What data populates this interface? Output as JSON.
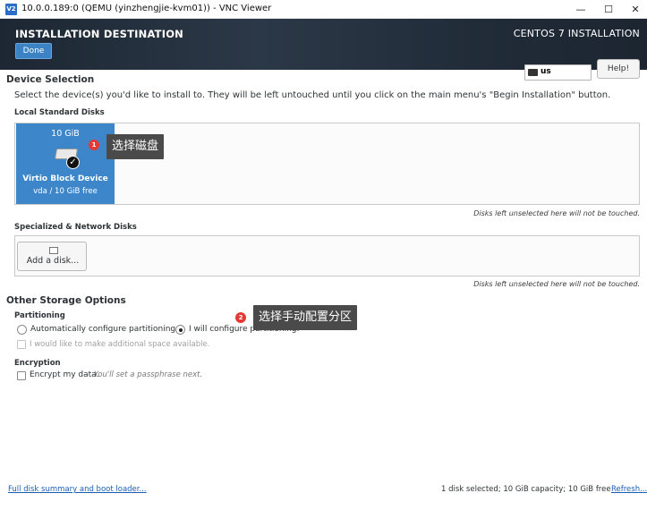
{
  "vnc": {
    "logo": "V2",
    "title": "10.0.0.189:0 (QEMU (yinzhengjie-kvm01)) - VNC Viewer",
    "minimize": "—",
    "maximize": "☐",
    "close": "✕"
  },
  "header": {
    "title": "INSTALLATION DESTINATION",
    "done_label": "Done",
    "product": "CENTOS 7 INSTALLATION",
    "keyboard_layout": "us",
    "help_label": "Help!"
  },
  "device_selection": {
    "title": "Device Selection",
    "description": "Select the device(s) you'd like to install to.  They will be left untouched until you click on the main menu's \"Begin Installation\" button.",
    "local_disks_title": "Local Standard Disks",
    "disk": {
      "size": "10 GiB",
      "name": "Virtio Block Device",
      "info": "vda  /  10 GiB free",
      "selected": true
    },
    "local_note": "Disks left unselected here will not be touched.",
    "specialized_title": "Specialized & Network Disks",
    "add_disk_label": "Add a disk...",
    "specialized_note": "Disks left unselected here will not be touched."
  },
  "other_storage": {
    "title": "Other Storage Options",
    "partitioning_title": "Partitioning",
    "auto_label": "Automatically configure partitioning.",
    "manual_label": "I will configure partitioning.",
    "selected_option": "manual",
    "extra_space_label": "I would like to make additional space available.",
    "encryption_title": "Encryption",
    "encrypt_label": "Encrypt my data.",
    "encrypt_hint": "You'll set a passphrase next."
  },
  "annotations": {
    "step1_number": "1",
    "step1_text": "选择磁盘",
    "step2_number": "2",
    "step2_text": "选择手动配置分区"
  },
  "footer": {
    "summary_link": "Full disk summary and boot loader...",
    "status": "1 disk selected; 10 GiB capacity; 10 GiB free",
    "refresh_link": "Refresh..."
  },
  "colors": {
    "selected_disk": "#3d86c9",
    "header_bg": "#2b3847",
    "callout_bg": "#4a4a4a",
    "badge": "#e53935",
    "link": "#1a5fb4"
  }
}
